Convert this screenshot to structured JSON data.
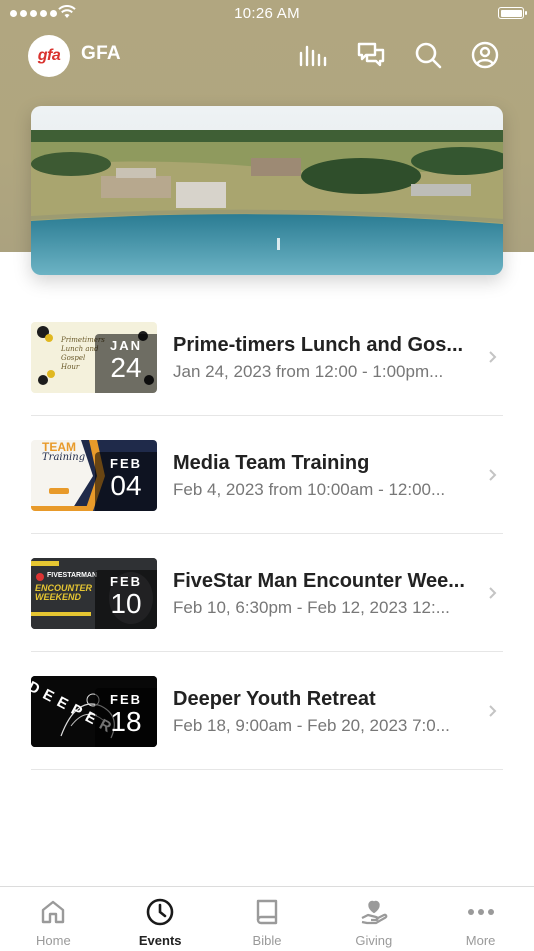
{
  "status_bar": {
    "time": "10:26 AM"
  },
  "header": {
    "logo_text": "gfa",
    "app_title": "GFA",
    "icons": [
      "stats-icon",
      "chat-icon",
      "search-icon",
      "profile-icon"
    ]
  },
  "events": [
    {
      "title": "Prime-timers Lunch and Gos...",
      "subtitle": "Jan 24, 2023 from 12:00 - 1:00pm...",
      "month": "JAN",
      "day": "24"
    },
    {
      "title": "Media Team Training",
      "subtitle": "Feb 4, 2023 from 10:00am - 12:00...",
      "month": "FEB",
      "day": "04"
    },
    {
      "title": "FiveStar Man Encounter Wee...",
      "subtitle": "Feb 10, 6:30pm - Feb 12, 2023 12:...",
      "month": "FEB",
      "day": "10"
    },
    {
      "title": "Deeper Youth Retreat",
      "subtitle": "Feb 18, 9:00am - Feb 20, 2023 7:0...",
      "month": "FEB",
      "day": "18"
    }
  ],
  "thumbnail_text": {
    "event0": "Primetimers Lunch and Gospel Hour",
    "event1_team": "TEAM",
    "event1_training": "Training",
    "event2": "FIVESTARMAN",
    "event2_line2": "ENCOUNTER",
    "event2_line3": "WEEKEND",
    "event3": "DEEPER"
  },
  "tabs": [
    {
      "label": "Home",
      "icon": "home-icon",
      "active": false
    },
    {
      "label": "Events",
      "icon": "clock-icon",
      "active": true
    },
    {
      "label": "Bible",
      "icon": "book-icon",
      "active": false
    },
    {
      "label": "Giving",
      "icon": "giving-heart-icon",
      "active": false
    },
    {
      "label": "More",
      "icon": "more-dots-icon",
      "active": false
    }
  ],
  "colors": {
    "header_bg": "#b1a680",
    "logo_red": "#d9332f",
    "active_tab": "#222222",
    "inactive_tab": "#9a9a9a"
  }
}
